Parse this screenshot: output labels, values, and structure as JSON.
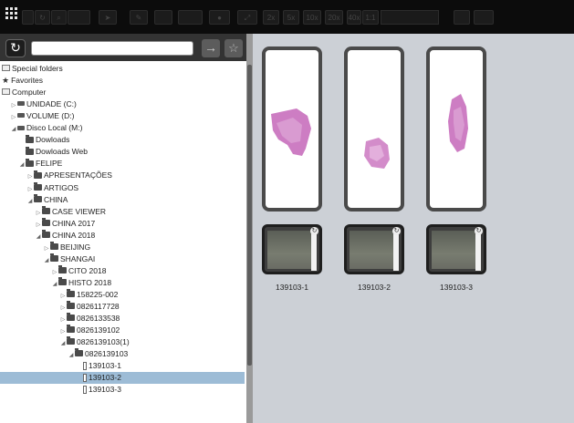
{
  "toolbar": {
    "magnifications": [
      "2x",
      "5x",
      "10x",
      "20x",
      "40x",
      "1:1"
    ]
  },
  "search": {
    "value": "",
    "placeholder": ""
  },
  "tree": [
    {
      "label": "Special folders",
      "icon": "special-folder-icon",
      "level": 0,
      "arrow": ""
    },
    {
      "label": "Favorites",
      "icon": "star-icon",
      "level": 0,
      "arrow": ""
    },
    {
      "label": "Computer",
      "icon": "computer-icon",
      "level": 0,
      "arrow": ""
    },
    {
      "label": "UNIDADE (C:)",
      "icon": "drive-icon",
      "level": 1,
      "arrow": "collapsed"
    },
    {
      "label": "VOLUME (D:)",
      "icon": "drive-icon",
      "level": 1,
      "arrow": "collapsed"
    },
    {
      "label": "Disco Local (M:)",
      "icon": "drive-icon",
      "level": 1,
      "arrow": "expanded"
    },
    {
      "label": "Dowloads",
      "icon": "folder-icon",
      "level": 2,
      "arrow": ""
    },
    {
      "label": "Dowloads Web",
      "icon": "folder-icon",
      "level": 2,
      "arrow": ""
    },
    {
      "label": "FELIPE",
      "icon": "folder-icon",
      "level": 2,
      "arrow": "expanded"
    },
    {
      "label": "APRESENTAÇÕES",
      "icon": "folder-icon",
      "level": 3,
      "arrow": "collapsed"
    },
    {
      "label": "ARTIGOS",
      "icon": "folder-icon",
      "level": 3,
      "arrow": "collapsed"
    },
    {
      "label": "CHINA",
      "icon": "folder-icon",
      "level": 3,
      "arrow": "expanded"
    },
    {
      "label": "CASE VIEWER",
      "icon": "folder-icon",
      "level": 4,
      "arrow": "collapsed"
    },
    {
      "label": "CHINA 2017",
      "icon": "folder-icon",
      "level": 4,
      "arrow": "collapsed"
    },
    {
      "label": "CHINA 2018",
      "icon": "folder-icon",
      "level": 4,
      "arrow": "expanded"
    },
    {
      "label": "BEIJING",
      "icon": "folder-icon",
      "level": 5,
      "arrow": "collapsed"
    },
    {
      "label": "SHANGAI",
      "icon": "folder-icon",
      "level": 5,
      "arrow": "expanded"
    },
    {
      "label": "CITO 2018",
      "icon": "folder-icon",
      "level": 6,
      "arrow": "collapsed"
    },
    {
      "label": "HISTO 2018",
      "icon": "folder-icon",
      "level": 6,
      "arrow": "expanded"
    },
    {
      "label": "158225-002",
      "icon": "folder-icon",
      "level": 7,
      "arrow": "collapsed"
    },
    {
      "label": "0826117728",
      "icon": "folder-icon",
      "level": 7,
      "arrow": "collapsed"
    },
    {
      "label": "0826133538",
      "icon": "folder-icon",
      "level": 7,
      "arrow": "collapsed"
    },
    {
      "label": "0826139102",
      "icon": "folder-icon",
      "level": 7,
      "arrow": "collapsed"
    },
    {
      "label": "0826139103(1)",
      "icon": "folder-icon",
      "level": 7,
      "arrow": "expanded"
    },
    {
      "label": "0826139103",
      "icon": "folder-icon",
      "level": 8,
      "arrow": "expanded"
    },
    {
      "label": "139103-1",
      "icon": "slide-file-icon",
      "level": 9,
      "arrow": ""
    },
    {
      "label": "139103-2",
      "icon": "slide-file-icon",
      "level": 9,
      "arrow": "",
      "selected": true
    },
    {
      "label": "139103-3",
      "icon": "slide-file-icon",
      "level": 9,
      "arrow": ""
    }
  ],
  "slides": [
    {
      "label": "139103-1"
    },
    {
      "label": "139103-2"
    },
    {
      "label": "139103-3"
    }
  ],
  "colors": {
    "toolbar_bg": "#0c0c0c",
    "selection": "#9dbcd6",
    "stain": "#c466b8",
    "panel_bg": "#ccd0d6"
  }
}
